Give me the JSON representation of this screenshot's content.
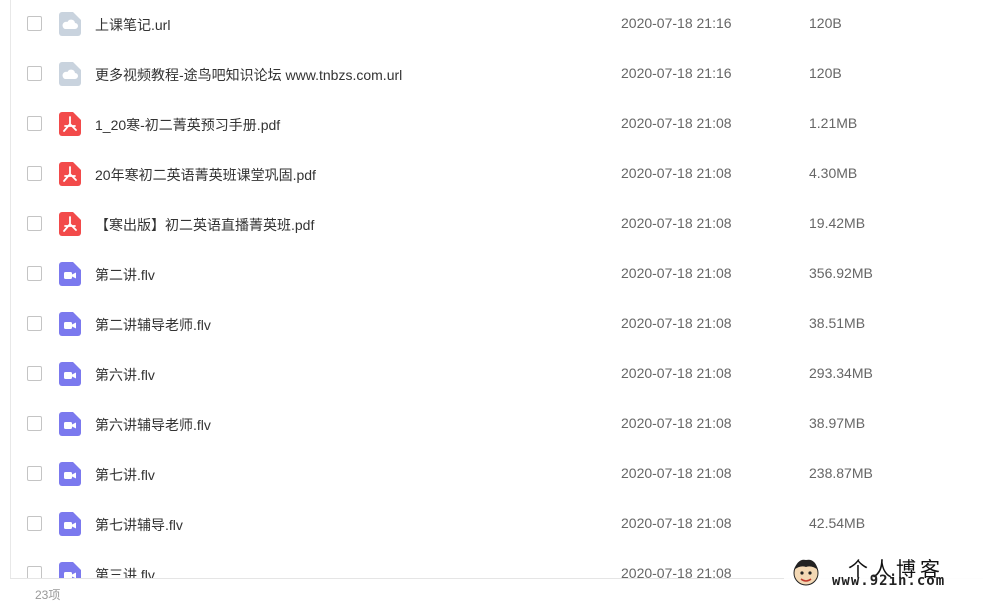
{
  "files": [
    {
      "name": "上课笔记.url",
      "date": "2020-07-18 21:16",
      "size": "120B",
      "icon": "cloud-link-icon"
    },
    {
      "name": "更多视频教程-途鸟吧知识论坛 www.tnbzs.com.url",
      "date": "2020-07-18 21:16",
      "size": "120B",
      "icon": "cloud-link-icon"
    },
    {
      "name": "1_20寒-初二菁英预习手册.pdf",
      "date": "2020-07-18 21:08",
      "size": "1.21MB",
      "icon": "pdf-icon"
    },
    {
      "name": "20年寒初二英语菁英班课堂巩固.pdf",
      "date": "2020-07-18 21:08",
      "size": "4.30MB",
      "icon": "pdf-icon"
    },
    {
      "name": "【寒出版】初二英语直播菁英班.pdf",
      "date": "2020-07-18 21:08",
      "size": "19.42MB",
      "icon": "pdf-icon"
    },
    {
      "name": "第二讲.flv",
      "date": "2020-07-18 21:08",
      "size": "356.92MB",
      "icon": "video-icon"
    },
    {
      "name": "第二讲辅导老师.flv",
      "date": "2020-07-18 21:08",
      "size": "38.51MB",
      "icon": "video-icon"
    },
    {
      "name": "第六讲.flv",
      "date": "2020-07-18 21:08",
      "size": "293.34MB",
      "icon": "video-icon"
    },
    {
      "name": "第六讲辅导老师.flv",
      "date": "2020-07-18 21:08",
      "size": "38.97MB",
      "icon": "video-icon"
    },
    {
      "name": "第七讲.flv",
      "date": "2020-07-18 21:08",
      "size": "238.87MB",
      "icon": "video-icon"
    },
    {
      "name": "第七讲辅导.flv",
      "date": "2020-07-18 21:08",
      "size": "42.54MB",
      "icon": "video-icon"
    },
    {
      "name": "第三讲.flv",
      "date": "2020-07-18 21:08",
      "size": "",
      "icon": "video-icon"
    }
  ],
  "footer": {
    "count": "23项"
  },
  "watermark": {
    "title": "个人博客",
    "url": "www.92in.com"
  },
  "colors": {
    "cloud": "#c9d3de",
    "pdf": "#f24a4a",
    "video": "#7b79ee"
  }
}
